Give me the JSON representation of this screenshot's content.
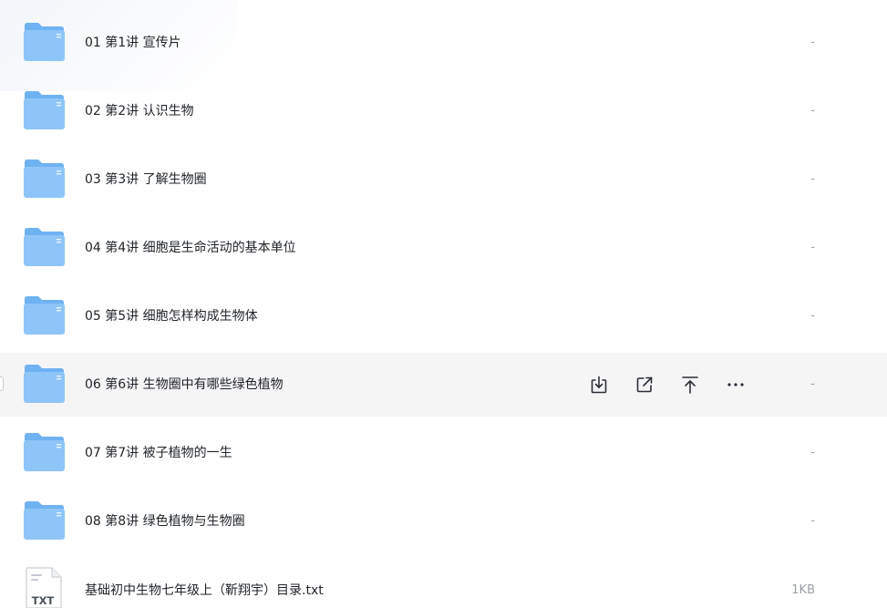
{
  "files": [
    {
      "name": "01 第1讲 宣传片",
      "size": "-",
      "type": "folder"
    },
    {
      "name": "02 第2讲 认识生物",
      "size": "-",
      "type": "folder"
    },
    {
      "name": "03 第3讲 了解生物圈",
      "size": "-",
      "type": "folder"
    },
    {
      "name": "04 第4讲 细胞是生命活动的基本单位",
      "size": "-",
      "type": "folder"
    },
    {
      "name": "05 第5讲 细胞怎样构成生物体",
      "size": "-",
      "type": "folder"
    },
    {
      "name": "06 第6讲 生物圈中有哪些绿色植物",
      "size": "-",
      "type": "folder"
    },
    {
      "name": "07 第7讲 被子植物的一生",
      "size": "-",
      "type": "folder"
    },
    {
      "name": "08 第8讲 绿色植物与生物圈",
      "size": "-",
      "type": "folder"
    },
    {
      "name": "基础初中生物七年级上（靳翔宇）目录.txt",
      "size": "1KB",
      "type": "txt",
      "icon_label": "TXT"
    }
  ],
  "row_actions": [
    {
      "name": "download-icon"
    },
    {
      "name": "share-icon"
    },
    {
      "name": "pin-to-top-icon"
    },
    {
      "name": "more-icon"
    }
  ],
  "colors": {
    "folder_front": "#8ec5f8",
    "folder_back": "#6fb2f2",
    "hover_bg": "#f5f5f6",
    "text": "#1f2328",
    "muted": "#9aa0a8"
  }
}
